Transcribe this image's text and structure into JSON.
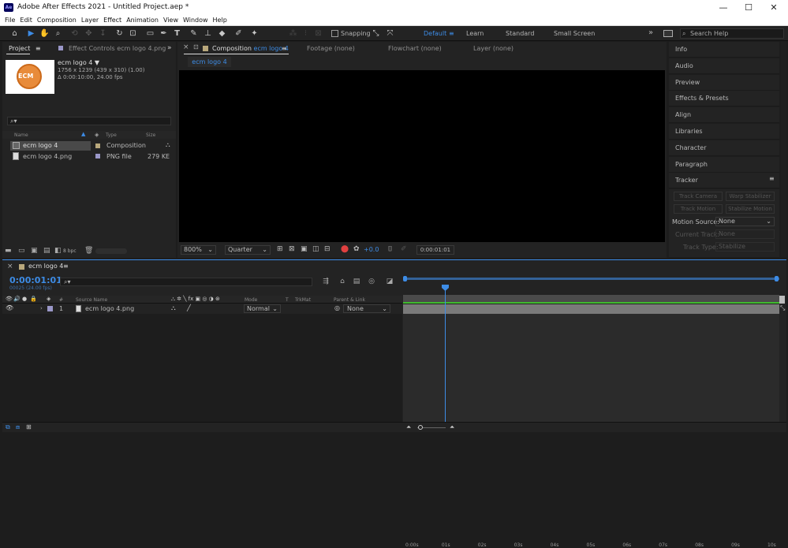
{
  "app": {
    "title": "Adobe After Effects 2021 - Untitled Project.aep *",
    "logo": "Ae",
    "window_controls": [
      "—",
      "☐",
      "✕"
    ]
  },
  "menus": [
    "File",
    "Edit",
    "Composition",
    "Layer",
    "Effect",
    "Animation",
    "View",
    "Window",
    "Help"
  ],
  "toolbar": {
    "snapping_label": "Snapping",
    "workspaces": [
      "Default",
      "Learn",
      "Standard",
      "Small Screen"
    ],
    "active_workspace": "Default",
    "search_placeholder": "Search Help"
  },
  "project_panel": {
    "tab_label": "Project",
    "effect_controls_label": "Effect Controls ecm logo 4.png",
    "preview_name": "ecm logo 4 ▼",
    "preview_dims": "1756 x 1239  (439 x 310) (1.00)",
    "preview_duration": "Δ 0:00:10:00, 24.00 fps",
    "thumb_text": "ECM",
    "search_glyph": "⌕▾",
    "columns": {
      "name": "Name",
      "type": "Type",
      "size": "Size"
    },
    "items": [
      {
        "name": "ecm logo 4",
        "type": "Composition",
        "size": ""
      },
      {
        "name": "ecm logo 4.png",
        "type": "PNG file",
        "size": "279 KE"
      }
    ],
    "bpc": "8 bpc"
  },
  "comp_panel": {
    "tab_prefix": "Composition",
    "tab_name": "ecm logo 4",
    "footage": "Footage  (none)",
    "flowchart": "Flowchart  (none)",
    "layer": "Layer  (none)",
    "subtab": "ecm logo 4",
    "zoom": "800%",
    "resolution": "Quarter",
    "exposure": "+0.0",
    "timecode": "0:00:01:01"
  },
  "right_panels": [
    "Info",
    "Audio",
    "Preview",
    "Effects & Presets",
    "Align",
    "Libraries",
    "Character",
    "Paragraph",
    "Tracker"
  ],
  "tracker": {
    "track_camera": "Track Camera",
    "warp_stabilizer": "Warp Stabilizer",
    "track_motion": "Track Motion",
    "stabilize_motion": "Stabilize Motion",
    "motion_source_label": "Motion Source:",
    "motion_source_value": "None",
    "current_track_label": "Current Track:",
    "current_track_value": "None",
    "track_type_label": "Track Type:",
    "track_type_value": "Stabilize"
  },
  "timeline": {
    "tab_label": "ecm logo 4",
    "timecode": "0:00:01:01",
    "frames": "00025 (24.00 fps)",
    "columns": {
      "num": "#",
      "source": "Source Name",
      "mode": "Mode",
      "t": "T",
      "trkmat": "TrkMat",
      "parent": "Parent & Link"
    },
    "layers": [
      {
        "num": "1",
        "name": "ecm logo 4.png",
        "mode": "Normal",
        "parent": "None"
      }
    ],
    "ruler": [
      "0:00s",
      "01s",
      "02s",
      "03s",
      "04s",
      "05s",
      "06s",
      "07s",
      "08s",
      "09s",
      "10s"
    ]
  }
}
